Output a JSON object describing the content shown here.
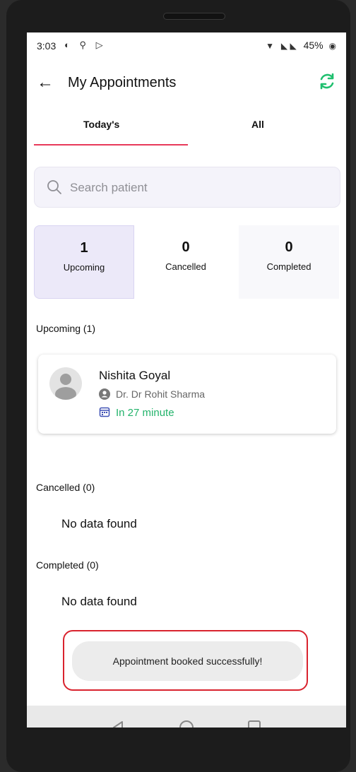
{
  "status_bar": {
    "time": "3:03",
    "battery": "45%"
  },
  "header": {
    "title": "My Appointments"
  },
  "tabs": [
    {
      "label": "Today's"
    },
    {
      "label": "All"
    }
  ],
  "search": {
    "placeholder": "Search patient"
  },
  "stats": [
    {
      "count": "1",
      "label": "Upcoming"
    },
    {
      "count": "0",
      "label": "Cancelled"
    },
    {
      "count": "0",
      "label": "Completed"
    }
  ],
  "sections": {
    "upcoming": "Upcoming (1)",
    "cancelled": "Cancelled (0)",
    "completed": "Completed (0)"
  },
  "appointment": {
    "patient": "Nishita Goyal",
    "doctor": "Dr. Dr Rohit Sharma",
    "time_until": "In 27 minute"
  },
  "empty_text": "No data found",
  "toast": {
    "message": "Appointment booked successfully!"
  },
  "colors": {
    "accent": "#e8395a",
    "refresh": "#1fbf6e",
    "time_green": "#23b36b",
    "highlight_outline": "#d9232e"
  },
  "icons": [
    "back-arrow-icon",
    "refresh-icon",
    "search-icon",
    "doctor-icon",
    "calendar-icon",
    "nav-back-icon",
    "nav-home-icon",
    "nav-recents-icon"
  ]
}
